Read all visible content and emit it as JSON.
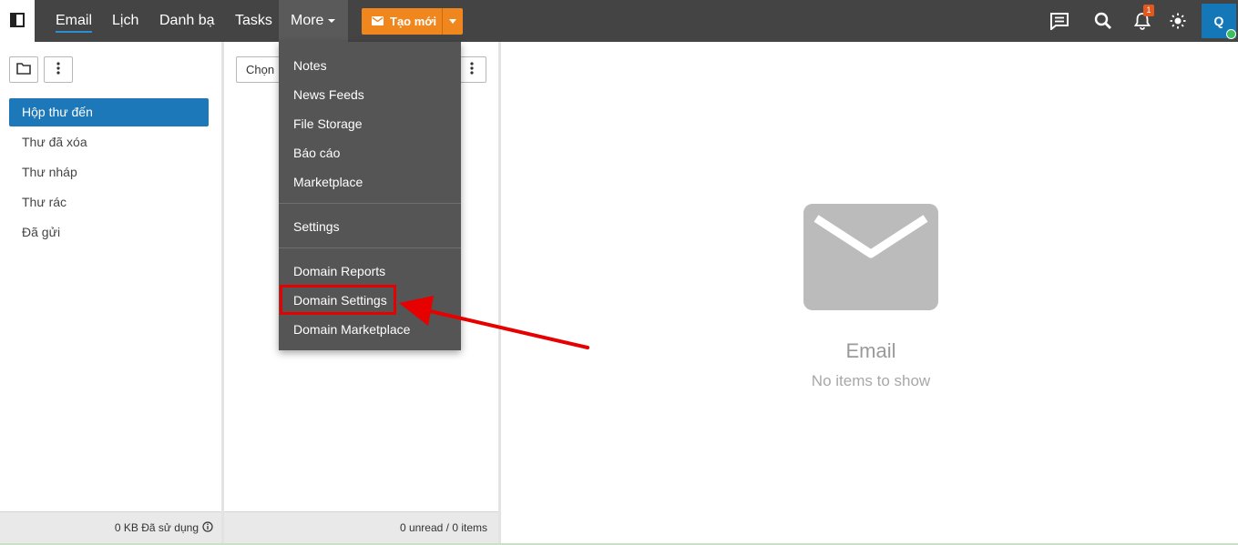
{
  "topbar": {
    "nav": [
      {
        "label": "Email",
        "active": true
      },
      {
        "label": "Lịch"
      },
      {
        "label": "Danh bạ"
      },
      {
        "label": "Tasks"
      }
    ],
    "more_label": "More",
    "new_button_label": "Tạo mới",
    "notification_count": "1",
    "avatar_initial": "Q",
    "icons": [
      "sidebar-toggle-icon",
      "chat-icon",
      "search-icon",
      "bell-icon",
      "theme-sun-icon"
    ]
  },
  "folders": {
    "items": [
      {
        "label": "Hộp thư đến",
        "active": true
      },
      {
        "label": "Thư đã xóa"
      },
      {
        "label": "Thư nháp"
      },
      {
        "label": "Thư rác"
      },
      {
        "label": "Đã gửi"
      }
    ],
    "footer": "0 KB Đã sử dụng"
  },
  "list": {
    "select_label": "Chọn",
    "footer": "0 unread / 0 items"
  },
  "more_menu": {
    "group1": [
      "Notes",
      "News Feeds",
      "File Storage",
      "Báo cáo",
      "Marketplace"
    ],
    "group2": [
      "Settings"
    ],
    "group3": [
      "Domain Reports",
      "Domain Settings",
      "Domain Marketplace"
    ],
    "highlighted": "Domain Settings"
  },
  "empty_state": {
    "title": "Email",
    "subtitle": "No items to show"
  },
  "colors": {
    "topbar": "#444444",
    "accent_blue": "#1d78b9",
    "new_button": "#f0871e",
    "menu_bg": "#555555",
    "annotation_red": "#e60000"
  }
}
